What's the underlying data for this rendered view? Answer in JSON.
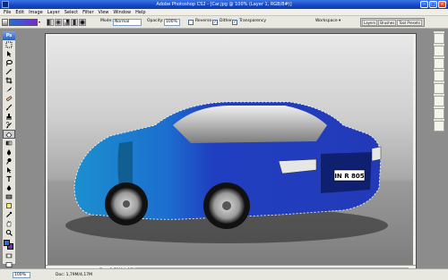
{
  "window": {
    "title": "Adobe Photoshop CS2 - [Car.jpg @ 100% (Layer 1, RGB/8#)]",
    "min_icon": "minimize-icon",
    "max_icon": "maximize-icon",
    "close_icon": "close-icon"
  },
  "menu": [
    "File",
    "Edit",
    "Image",
    "Layer",
    "Select",
    "Filter",
    "View",
    "Window",
    "Help"
  ],
  "options": {
    "mode_label": "Mode:",
    "mode_value": "Normal",
    "opacity_label": "Opacity:",
    "opacity_value": "100%",
    "reverse_label": "Reverse",
    "reverse_checked": false,
    "dither_label": "Dither",
    "dither_checked": true,
    "transparency_label": "Transparency",
    "transparency_checked": true,
    "workspace_label": "Workspace"
  },
  "palette_tabs": [
    "Layers",
    "Brushes",
    "Tool Presets"
  ],
  "colors": {
    "foreground": "#1e6fe0",
    "background": "#7b28c8",
    "car_blue": "#1f3fc0",
    "car_blue_light": "#1d8fd2"
  },
  "status": {
    "zoom": "100%",
    "doc_label": "Doc: 1,79M/4,17M",
    "doc_zoom": "100%"
  },
  "plate": "IN R 805"
}
